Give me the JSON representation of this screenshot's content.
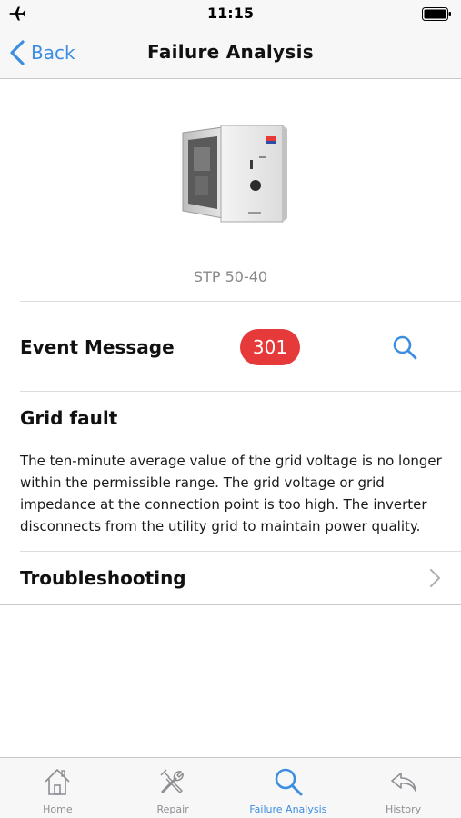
{
  "status_bar": {
    "time": "11:15",
    "airplane_icon": "airplane-icon",
    "battery_icon": "battery-icon"
  },
  "nav": {
    "back_label": "Back",
    "title": "Failure Analysis"
  },
  "product": {
    "name": "STP 50-40",
    "image_icon": "inverter-image"
  },
  "event": {
    "label": "Event Message",
    "code": "301",
    "badge_color": "#e63a3a",
    "search_icon": "search-icon"
  },
  "fault": {
    "title": "Grid fault",
    "description": "The ten-minute average value of the grid voltage is no longer within the permissible range. The grid voltage or grid impedance at the connection point is too high. The inverter disconnects from the utility grid to maintain power quality."
  },
  "troubleshooting": {
    "label": "Troubleshooting"
  },
  "tabs": [
    {
      "label": "Home",
      "icon": "home-icon",
      "active": false
    },
    {
      "label": "Repair",
      "icon": "tools-icon",
      "active": false
    },
    {
      "label": "Failure Analysis",
      "icon": "search-icon",
      "active": true
    },
    {
      "label": "History",
      "icon": "reply-icon",
      "active": false
    }
  ],
  "colors": {
    "accent": "#3d8ee0",
    "inactive_tab": "#8e8e93"
  }
}
